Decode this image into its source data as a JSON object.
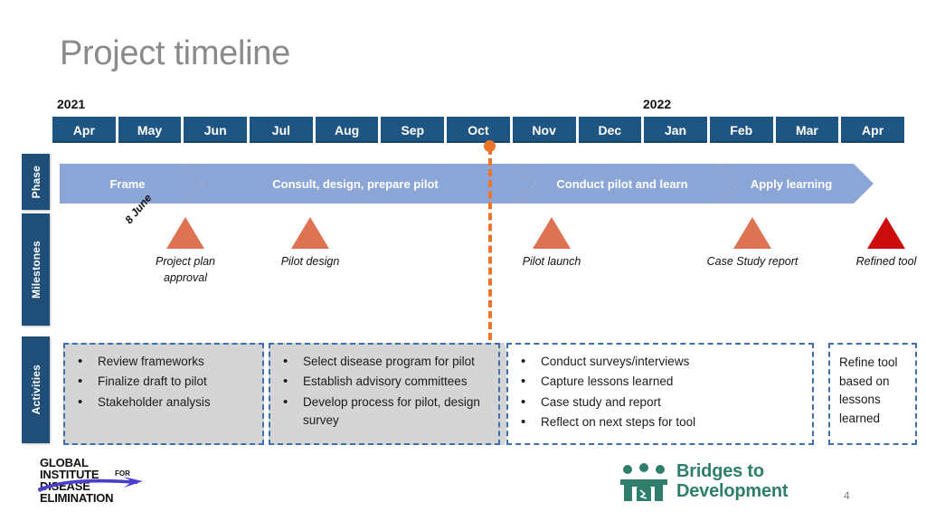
{
  "slide": {
    "title": "Project timeline",
    "number": "4"
  },
  "timeline": {
    "years": [
      {
        "label": "2021"
      },
      {
        "label": "2022"
      }
    ],
    "months": [
      "Apr",
      "May",
      "Jun",
      "Jul",
      "Aug",
      "Sep",
      "Oct",
      "Nov",
      "Dec",
      "Jan",
      "Feb",
      "Mar",
      "Apr"
    ],
    "today_marker": {
      "position_month": "Oct"
    }
  },
  "rows": {
    "phase_label": "Phase",
    "milestones_label": "Milestones",
    "activities_label": "Activities"
  },
  "phases": [
    {
      "label": "Frame"
    },
    {
      "label": "Consult, design, prepare pilot"
    },
    {
      "label": "Conduct pilot and learn"
    },
    {
      "label": "Apply learning"
    }
  ],
  "milestones": [
    {
      "date": "8 June",
      "label_line1": "Project plan",
      "label_line2": "approval",
      "color": "#dd7352"
    },
    {
      "date": "",
      "label_line1": "Pilot design",
      "label_line2": "",
      "color": "#dd7352"
    },
    {
      "date": "",
      "label_line1": "Pilot launch",
      "label_line2": "",
      "color": "#dd7352"
    },
    {
      "date": "",
      "label_line1": "Case Study report",
      "label_line2": "",
      "color": "#dd7352"
    },
    {
      "date": "",
      "label_line1": "Refined tool",
      "label_line2": "",
      "color": "#cc0d0d"
    }
  ],
  "activities": [
    {
      "items": [
        "Review frameworks",
        "Finalize draft to pilot",
        "Stakeholder analysis"
      ]
    },
    {
      "items": [
        "Select disease program for pilot",
        "Establish advisory committees",
        "Develop process for pilot, design survey"
      ]
    },
    {
      "items": [
        "Conduct surveys/interviews",
        "Capture lessons learned",
        "Case study and report",
        "Reflect on next steps for tool"
      ]
    },
    {
      "text": "Refine tool based on lessons learned"
    }
  ],
  "logos": {
    "gide": {
      "line1": "GLOBAL",
      "line2": "INSTITUTE",
      "for": "FOR",
      "line3": "DISEASE",
      "line4": "ELIMINATION",
      "swoosh_color": "#4b3fd0"
    },
    "bridges": {
      "line1": "Bridges to",
      "line2": "Development",
      "color": "#2f7e6b"
    }
  },
  "colors": {
    "month_bar": "#1f5582",
    "row_label": "#1f4e79",
    "phase": "#8ba5d6",
    "milestone": "#dd7352",
    "milestone_final": "#cc0d0d",
    "today_line": "#e8762c",
    "activity_border": "#3f6fad",
    "activity_fill": "#d5d5d5",
    "title": "#8a8a8a"
  }
}
